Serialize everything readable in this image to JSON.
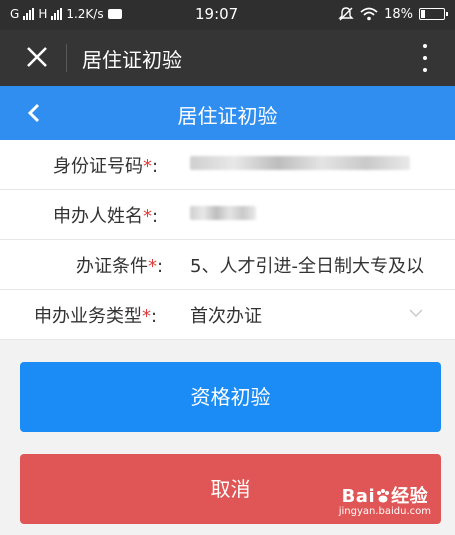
{
  "status": {
    "carrier1": "G",
    "carrier2": "H",
    "speed": "1.2K/s",
    "time": "19:07",
    "battery": "18%",
    "battery_level": 0.18
  },
  "wechat_nav": {
    "title": "居住证初验"
  },
  "header": {
    "title": "居住证初验"
  },
  "form": {
    "rows": [
      {
        "label": "身份证号码",
        "required": "*",
        "colon": ":",
        "value": ""
      },
      {
        "label": "申办人姓名",
        "required": "*",
        "colon": ":",
        "value": ""
      },
      {
        "label": "办证条件",
        "required": "*",
        "colon": ":",
        "value": "5、人才引进-全日制大专及以"
      },
      {
        "label": "申办业务类型",
        "required": "*",
        "colon": ":",
        "value": "首次办证"
      }
    ]
  },
  "buttons": {
    "submit": "资格初验",
    "cancel": "取消"
  },
  "watermark": {
    "brand_left": "Bai",
    "brand_right": "经验",
    "url": "jingyan.baidu.com"
  },
  "colors": {
    "header_blue": "#2f8ef0",
    "primary": "#1b8bf5",
    "danger": "#e05555",
    "required": "#e23b3b"
  }
}
